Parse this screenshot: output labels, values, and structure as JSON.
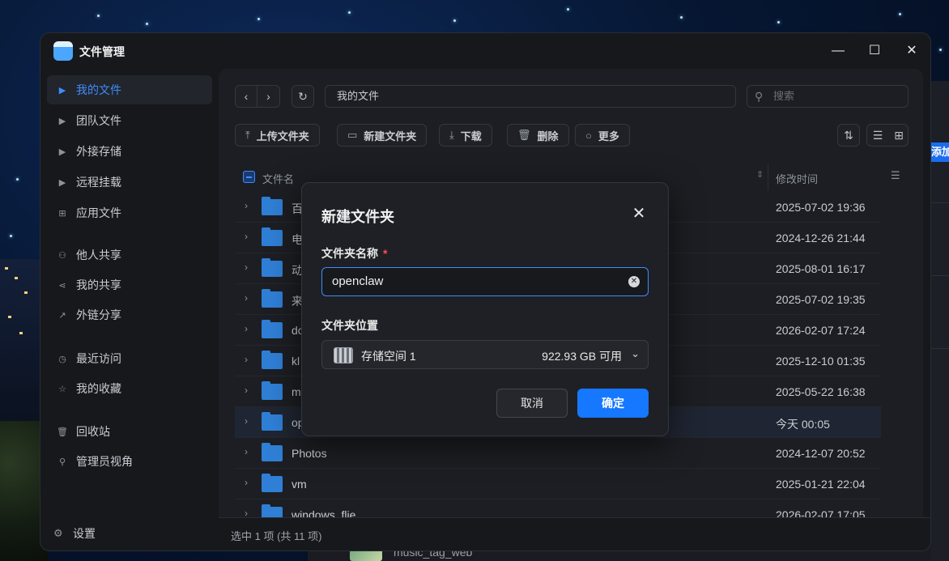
{
  "window": {
    "title": "文件管理"
  },
  "sidebar": {
    "items": [
      {
        "label": "我的文件",
        "icon": "caret-right-icon",
        "active": true
      },
      {
        "label": "团队文件",
        "icon": "caret-right-icon"
      },
      {
        "label": "外接存储",
        "icon": "caret-right-icon"
      },
      {
        "label": "远程挂载",
        "icon": "caret-right-icon"
      },
      {
        "label": "应用文件",
        "icon": "grid-icon"
      },
      {
        "label": "他人共享",
        "icon": "users-icon"
      },
      {
        "label": "我的共享",
        "icon": "share-icon"
      },
      {
        "label": "外链分享",
        "icon": "external-link-icon"
      },
      {
        "label": "最近访问",
        "icon": "clock-icon"
      },
      {
        "label": "我的收藏",
        "icon": "star-icon"
      },
      {
        "label": "回收站",
        "icon": "trash-icon"
      },
      {
        "label": "管理员视角",
        "icon": "admin-icon"
      }
    ],
    "settings_label": "设置"
  },
  "nav": {
    "path": "我的文件",
    "search_placeholder": "搜索"
  },
  "toolbar": {
    "upload": "上传文件夹",
    "new_folder": "新建文件夹",
    "download": "下载",
    "delete": "删除",
    "more": "更多"
  },
  "table": {
    "col_name": "文件名",
    "col_modified": "修改时间",
    "rows": [
      {
        "name": "百",
        "modified": "2025-07-02 19:36"
      },
      {
        "name": "电",
        "modified": "2024-12-26 21:44"
      },
      {
        "name": "动",
        "modified": "2025-08-01 16:17"
      },
      {
        "name": "来",
        "modified": "2025-07-02 19:35"
      },
      {
        "name": "dc",
        "modified": "2026-02-07 17:24"
      },
      {
        "name": "kl",
        "modified": "2025-12-10 01:35"
      },
      {
        "name": "me",
        "modified": "2025-05-22 16:38"
      },
      {
        "name": "op",
        "modified": "今天 00:05",
        "selected": true
      },
      {
        "name": "Photos",
        "modified": "2024-12-07 20:52"
      },
      {
        "name": "vm",
        "modified": "2025-01-21 22:04"
      },
      {
        "name": "windows_flie",
        "modified": "2026-02-07 17:05"
      }
    ]
  },
  "status": {
    "text": "选中 1 项 (共 11 项)"
  },
  "dialog": {
    "title": "新建文件夹",
    "name_label": "文件夹名称",
    "required_mark": "*",
    "name_value": "openclaw",
    "location_label": "文件夹位置",
    "location_name": "存储空间 1",
    "location_free": "922.93 GB 可用",
    "cancel": "取消",
    "confirm": "确定"
  },
  "background": {
    "right_button": "添加",
    "bottom_item": "music_tag_web"
  },
  "colors": {
    "accent": "#1677ff",
    "folder": "#2f7fd6",
    "required": "#ff4d4f"
  }
}
